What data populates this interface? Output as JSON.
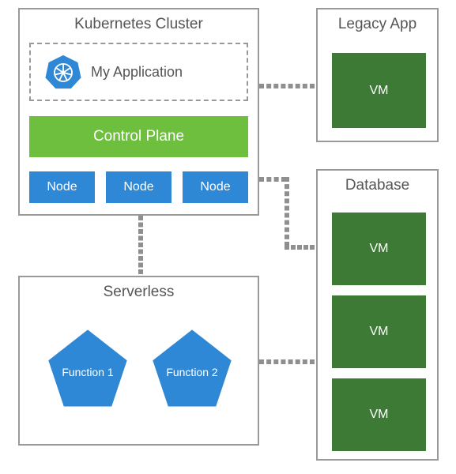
{
  "kubernetes_cluster": {
    "title": "Kubernetes Cluster",
    "my_application": {
      "label": "My Application",
      "icon": "kubernetes-wheel-icon"
    },
    "control_plane_label": "Control Plane",
    "nodes": [
      "Node",
      "Node",
      "Node"
    ]
  },
  "legacy_app": {
    "title": "Legacy App",
    "vm_label": "VM"
  },
  "database": {
    "title": "Database",
    "vms": [
      "VM",
      "VM",
      "VM"
    ]
  },
  "serverless": {
    "title": "Serverless",
    "functions": [
      "Function 1",
      "Function 2"
    ]
  },
  "colors": {
    "blue": "#2f88d6",
    "green_bright": "#6fbf3f",
    "green_dark": "#3d7a35",
    "border_gray": "#999999"
  },
  "connections": [
    {
      "from": "kubernetes_cluster",
      "to": "legacy_app",
      "style": "dashed"
    },
    {
      "from": "kubernetes_cluster",
      "to": "database",
      "style": "dashed"
    },
    {
      "from": "kubernetes_cluster",
      "to": "serverless",
      "style": "dashed"
    },
    {
      "from": "serverless",
      "to": "database",
      "style": "dashed"
    }
  ]
}
